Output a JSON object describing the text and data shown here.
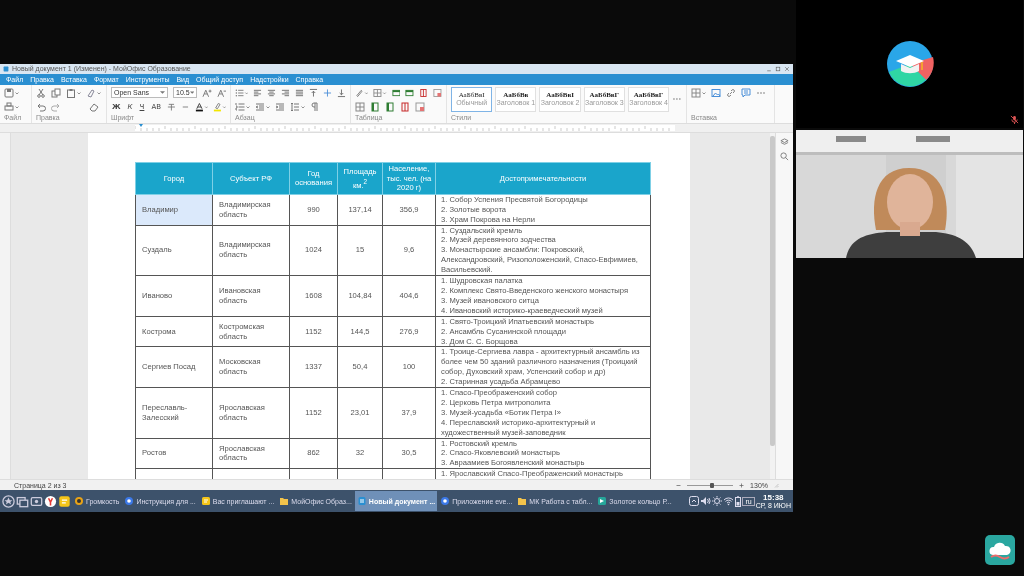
{
  "window": {
    "title": "Новый документ 1 (Изменен) - МойОфис Образование"
  },
  "menu": [
    "Файл",
    "Правка",
    "Вставка",
    "Формат",
    "Инструменты",
    "Вид",
    "Общий доступ",
    "Надстройки",
    "Справка"
  ],
  "toolbar": {
    "groups": [
      "Файл",
      "Правка",
      "Шрифт",
      "Абзац",
      "Таблица",
      "Стили",
      "Вставка"
    ],
    "font": "Open Sans",
    "size": "10.5",
    "format_buttons": [
      "Ж",
      "К",
      "Ч",
      "АВ"
    ],
    "styles": [
      {
        "sample": "АаБбВвІ",
        "name": "Обычный",
        "selected": true
      },
      {
        "sample": "АаБбВв",
        "name": "Заголовок 1",
        "selected": false
      },
      {
        "sample": "АаБбВвІ",
        "name": "Заголовок 2",
        "selected": false
      },
      {
        "sample": "АаБбВвГ",
        "name": "Заголовок 3",
        "selected": false
      },
      {
        "sample": "АаБбВвГ",
        "name": "Заголовок 4",
        "selected": false
      }
    ]
  },
  "table": {
    "columns": [
      "Город",
      "Субъект РФ",
      "Год основания",
      "Площадь км.$^{2}$",
      "Население, тыс. чел. (на 2020 г)",
      "Достопримечательности"
    ],
    "rows": [
      {
        "city": "Владимир",
        "city_selected": true,
        "region": "Владимирская область",
        "founded": "990",
        "area": "137,14",
        "population": "356,9",
        "sights": [
          "1. Собор Успения Пресвятой Богородицы",
          "2. Золотые ворота",
          "3. Храм Покрова на Нерли"
        ]
      },
      {
        "city": "Суздаль",
        "city_selected": false,
        "region": "Владимирская область",
        "founded": "1024",
        "area": "15",
        "population": "9,6",
        "sights": [
          "1. Суздальский кремль",
          "2. Музей деревянного зодчества",
          "3. Монастырские ансамбли: Покровский, Александровский, Ризоположенский, Спасо-Евфимиев, Васильевский."
        ]
      },
      {
        "city": "Иваново",
        "city_selected": false,
        "region": "Ивановская область",
        "founded": "1608",
        "area": "104,84",
        "population": "404,6",
        "sights": [
          "1. Шудровская палатка",
          "2. Комплекс Свято-Введенского женского монастыря",
          "3. Музей ивановского ситца",
          "4. Ивановский историко-краеведческий музей"
        ]
      },
      {
        "city": "Кострома",
        "city_selected": false,
        "region": "Костромская область",
        "founded": "1152",
        "area": "144,5",
        "population": "276,9",
        "sights": [
          "1. Свято-Троицкий Ипатьевский монастырь",
          "2. Ансамбль Сусанинской площади",
          "3. Дом С. С. Борщова"
        ]
      },
      {
        "city": "Сергиев Посад",
        "city_selected": false,
        "region": "Московская область",
        "founded": "1337",
        "area": "50,4",
        "population": "100",
        "sights": [
          "1. Троице-Сергиева лавра - архитектурный ансамбль из более чем 50 зданий различного назначения (Троицкий собор, Духовский храм, Успенский собор и др)",
          "2. Старинная усадьба Абрамцево"
        ]
      },
      {
        "city": "Переславль-Залесский",
        "city_selected": false,
        "region": "Ярославская область",
        "founded": "1152",
        "area": "23,01",
        "population": "37,9",
        "sights": [
          "1. Спасо-Преображенский собор",
          "2. Церковь Петра митрополита",
          "3. Музей-усадьба «Ботик Петра I»",
          "4. Переславский историко-архитектурный и художественный музей-заповедник"
        ]
      },
      {
        "city": "Ростов",
        "city_selected": false,
        "region": "Ярославская область",
        "founded": "862",
        "area": "32",
        "population": "30,5",
        "sights": [
          "1. Ростовский кремль",
          "2. Спасо-Яковлевский монастырь",
          "3. Авраамиев Богоявленский монастырь"
        ]
      },
      {
        "sights": [
          "1. Ярославский Спасо-Преображенский монастырь"
        ]
      }
    ]
  },
  "status_bar": {
    "page": "Страница 2 из 3",
    "zoom": {
      "level": 0.55,
      "reading": "130%"
    }
  },
  "taskbar": {
    "tasks": [
      {
        "label": "Громкость",
        "kind": "ring",
        "selected": false
      },
      {
        "label": "Инструкция для ...",
        "kind": "browser",
        "selected": false
      },
      {
        "label": "Вас приглашают ...",
        "kind": "note",
        "selected": false
      },
      {
        "label": "МойОфис Образ...",
        "kind": "folder",
        "selected": false
      },
      {
        "label": "Новый документ ...",
        "kind": "document",
        "selected": true
      },
      {
        "label": "Приложение eve...",
        "kind": "browser",
        "selected": false
      },
      {
        "label": "МК Работа с табл...",
        "kind": "folder",
        "selected": false
      },
      {
        "label": "Золотое кольцо Р...",
        "kind": "slides",
        "selected": false
      }
    ],
    "language": "ru",
    "time": "15:38",
    "date": "СР, 8 ИЮН"
  },
  "participants": [
    {
      "kind": "logo",
      "muted": true
    },
    {
      "kind": "camera",
      "muted": false
    }
  ]
}
